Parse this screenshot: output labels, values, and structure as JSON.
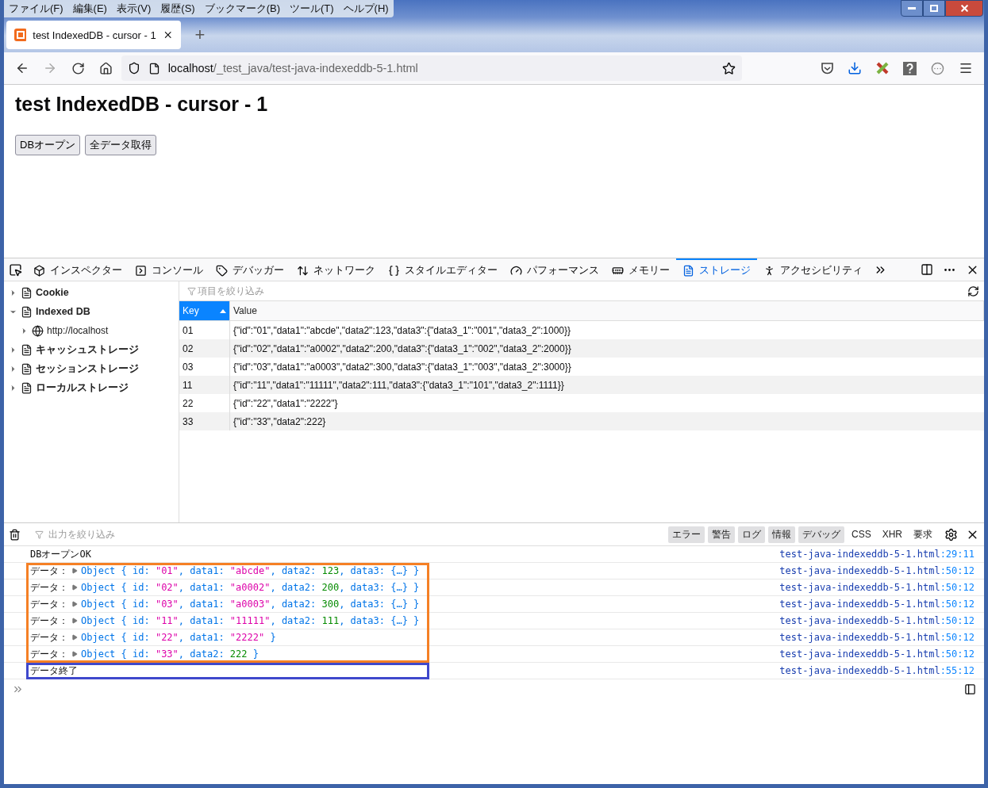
{
  "menu_bar": [
    "ファイル(F)",
    "編集(E)",
    "表示(V)",
    "履歴(S)",
    "ブックマーク(B)",
    "ツール(T)",
    "ヘルプ(H)"
  ],
  "tabs": [
    {
      "title": "test IndexedDB - cursor - 1",
      "selected": true
    }
  ],
  "new_tab": "+",
  "address": {
    "host": "localhost",
    "path": "/_test_java/test-java-indexeddb-5-1.html"
  },
  "page": {
    "heading": "test IndexedDB - cursor - 1",
    "buttons": [
      "DBオープン",
      "全データ取得"
    ]
  },
  "devtools_tabs": [
    {
      "kind": "inspector",
      "label": "インスペクター",
      "selected": false
    },
    {
      "kind": "console",
      "label": "コンソール",
      "selected": false
    },
    {
      "kind": "debugger",
      "label": "デバッガー",
      "selected": false
    },
    {
      "kind": "network",
      "label": "ネットワーク",
      "selected": false
    },
    {
      "kind": "style",
      "label": "スタイルエディター",
      "selected": false
    },
    {
      "kind": "performance",
      "label": "パフォーマンス",
      "selected": false
    },
    {
      "kind": "memory",
      "label": "メモリー",
      "selected": false
    },
    {
      "kind": "storage",
      "label": "ストレージ",
      "selected": true
    },
    {
      "kind": "accessibility",
      "label": "アクセシビリティ",
      "selected": false
    }
  ],
  "storage_tree": [
    {
      "label": "Cookie",
      "expanded": false
    },
    {
      "label": "Indexed DB",
      "expanded": true,
      "children": [
        {
          "label": "http://localhost",
          "expanded": false
        }
      ]
    },
    {
      "label": "キャッシュストレージ",
      "expanded": false
    },
    {
      "label": "セッションストレージ",
      "expanded": false
    },
    {
      "label": "ローカルストレージ",
      "expanded": false
    }
  ],
  "storage_filter": {
    "placeholder": "項目を絞り込み"
  },
  "table": {
    "columns": [
      {
        "label": "Key",
        "sorted": true
      },
      {
        "label": "Value",
        "sorted": false
      }
    ],
    "rows": [
      [
        "01",
        "{\"id\":\"01\",\"data1\":\"abcde\",\"data2\":123,\"data3\":{\"data3_1\":\"001\",\"data3_2\":1000}}"
      ],
      [
        "02",
        "{\"id\":\"02\",\"data1\":\"a0002\",\"data2\":200,\"data3\":{\"data3_1\":\"002\",\"data3_2\":2000}}"
      ],
      [
        "03",
        "{\"id\":\"03\",\"data1\":\"a0003\",\"data2\":300,\"data3\":{\"data3_1\":\"003\",\"data3_2\":3000}}"
      ],
      [
        "11",
        "{\"id\":\"11\",\"data1\":\"11111\",\"data2\":111,\"data3\":{\"data3_1\":\"101\",\"data3_2\":1111}}"
      ],
      [
        "22",
        "{\"id\":\"22\",\"data1\":\"2222\"}"
      ],
      [
        "33",
        "{\"id\":\"33\",\"data2\":222}"
      ]
    ]
  },
  "console_filter": {
    "placeholder": "出力を絞り込み"
  },
  "console_levels": [
    {
      "label": "エラー",
      "selected": true
    },
    {
      "label": "警告",
      "selected": true
    },
    {
      "label": "ログ",
      "selected": true
    },
    {
      "label": "情報",
      "selected": true
    },
    {
      "label": "デバッグ",
      "selected": true
    },
    {
      "label": "CSS",
      "selected": false
    },
    {
      "label": "XHR",
      "selected": false
    },
    {
      "label": "要求",
      "selected": false
    }
  ],
  "console_groups": [
    {
      "entries": [
        {
          "kind": "text",
          "text": "DBオープンOK",
          "source": "test-java-indexeddb-5-1.html",
          "position": ":29:11"
        }
      ]
    },
    {
      "color": "#f58025",
      "entries": [
        {
          "kind": "object",
          "label": "データ：",
          "tokens": [
            {
              "kind": "punct",
              "text": "Object { id: "
            },
            {
              "kind": "string",
              "text": "\"01\""
            },
            {
              "kind": "punct",
              "text": ", data1: "
            },
            {
              "kind": "string",
              "text": "\"abcde\""
            },
            {
              "kind": "punct",
              "text": ", data2: "
            },
            {
              "kind": "number",
              "text": "123"
            },
            {
              "kind": "punct",
              "text": ", data3: {…} }"
            }
          ],
          "source": "test-java-indexeddb-5-1.html",
          "position": ":50:12"
        },
        {
          "kind": "object",
          "label": "データ：",
          "tokens": [
            {
              "kind": "punct",
              "text": "Object { id: "
            },
            {
              "kind": "string",
              "text": "\"02\""
            },
            {
              "kind": "punct",
              "text": ", data1: "
            },
            {
              "kind": "string",
              "text": "\"a0002\""
            },
            {
              "kind": "punct",
              "text": ", data2: "
            },
            {
              "kind": "number",
              "text": "200"
            },
            {
              "kind": "punct",
              "text": ", data3: {…} }"
            }
          ],
          "source": "test-java-indexeddb-5-1.html",
          "position": ":50:12"
        },
        {
          "kind": "object",
          "label": "データ：",
          "tokens": [
            {
              "kind": "punct",
              "text": "Object { id: "
            },
            {
              "kind": "string",
              "text": "\"03\""
            },
            {
              "kind": "punct",
              "text": ", data1: "
            },
            {
              "kind": "string",
              "text": "\"a0003\""
            },
            {
              "kind": "punct",
              "text": ", data2: "
            },
            {
              "kind": "number",
              "text": "300"
            },
            {
              "kind": "punct",
              "text": ", data3: {…} }"
            }
          ],
          "source": "test-java-indexeddb-5-1.html",
          "position": ":50:12"
        },
        {
          "kind": "object",
          "label": "データ：",
          "tokens": [
            {
              "kind": "punct",
              "text": "Object { id: "
            },
            {
              "kind": "string",
              "text": "\"11\""
            },
            {
              "kind": "punct",
              "text": ", data1: "
            },
            {
              "kind": "string",
              "text": "\"11111\""
            },
            {
              "kind": "punct",
              "text": ", data2: "
            },
            {
              "kind": "number",
              "text": "111"
            },
            {
              "kind": "punct",
              "text": ", data3: {…} }"
            }
          ],
          "source": "test-java-indexeddb-5-1.html",
          "position": ":50:12"
        },
        {
          "kind": "object",
          "label": "データ：",
          "tokens": [
            {
              "kind": "punct",
              "text": "Object { id: "
            },
            {
              "kind": "string",
              "text": "\"22\""
            },
            {
              "kind": "punct",
              "text": ", data1: "
            },
            {
              "kind": "string",
              "text": "\"2222\""
            },
            {
              "kind": "punct",
              "text": " }"
            }
          ],
          "source": "test-java-indexeddb-5-1.html",
          "position": ":50:12"
        },
        {
          "kind": "object",
          "label": "データ：",
          "tokens": [
            {
              "kind": "punct",
              "text": "Object { id: "
            },
            {
              "kind": "string",
              "text": "\"33\""
            },
            {
              "kind": "punct",
              "text": ", data2: "
            },
            {
              "kind": "number",
              "text": "222"
            },
            {
              "kind": "punct",
              "text": " }"
            }
          ],
          "source": "test-java-indexeddb-5-1.html",
          "position": ":50:12"
        }
      ]
    },
    {
      "color": "#3f48cc",
      "entries": [
        {
          "kind": "text",
          "text": "データ終了",
          "source": "test-java-indexeddb-5-1.html",
          "position": ":55:12"
        }
      ]
    }
  ]
}
